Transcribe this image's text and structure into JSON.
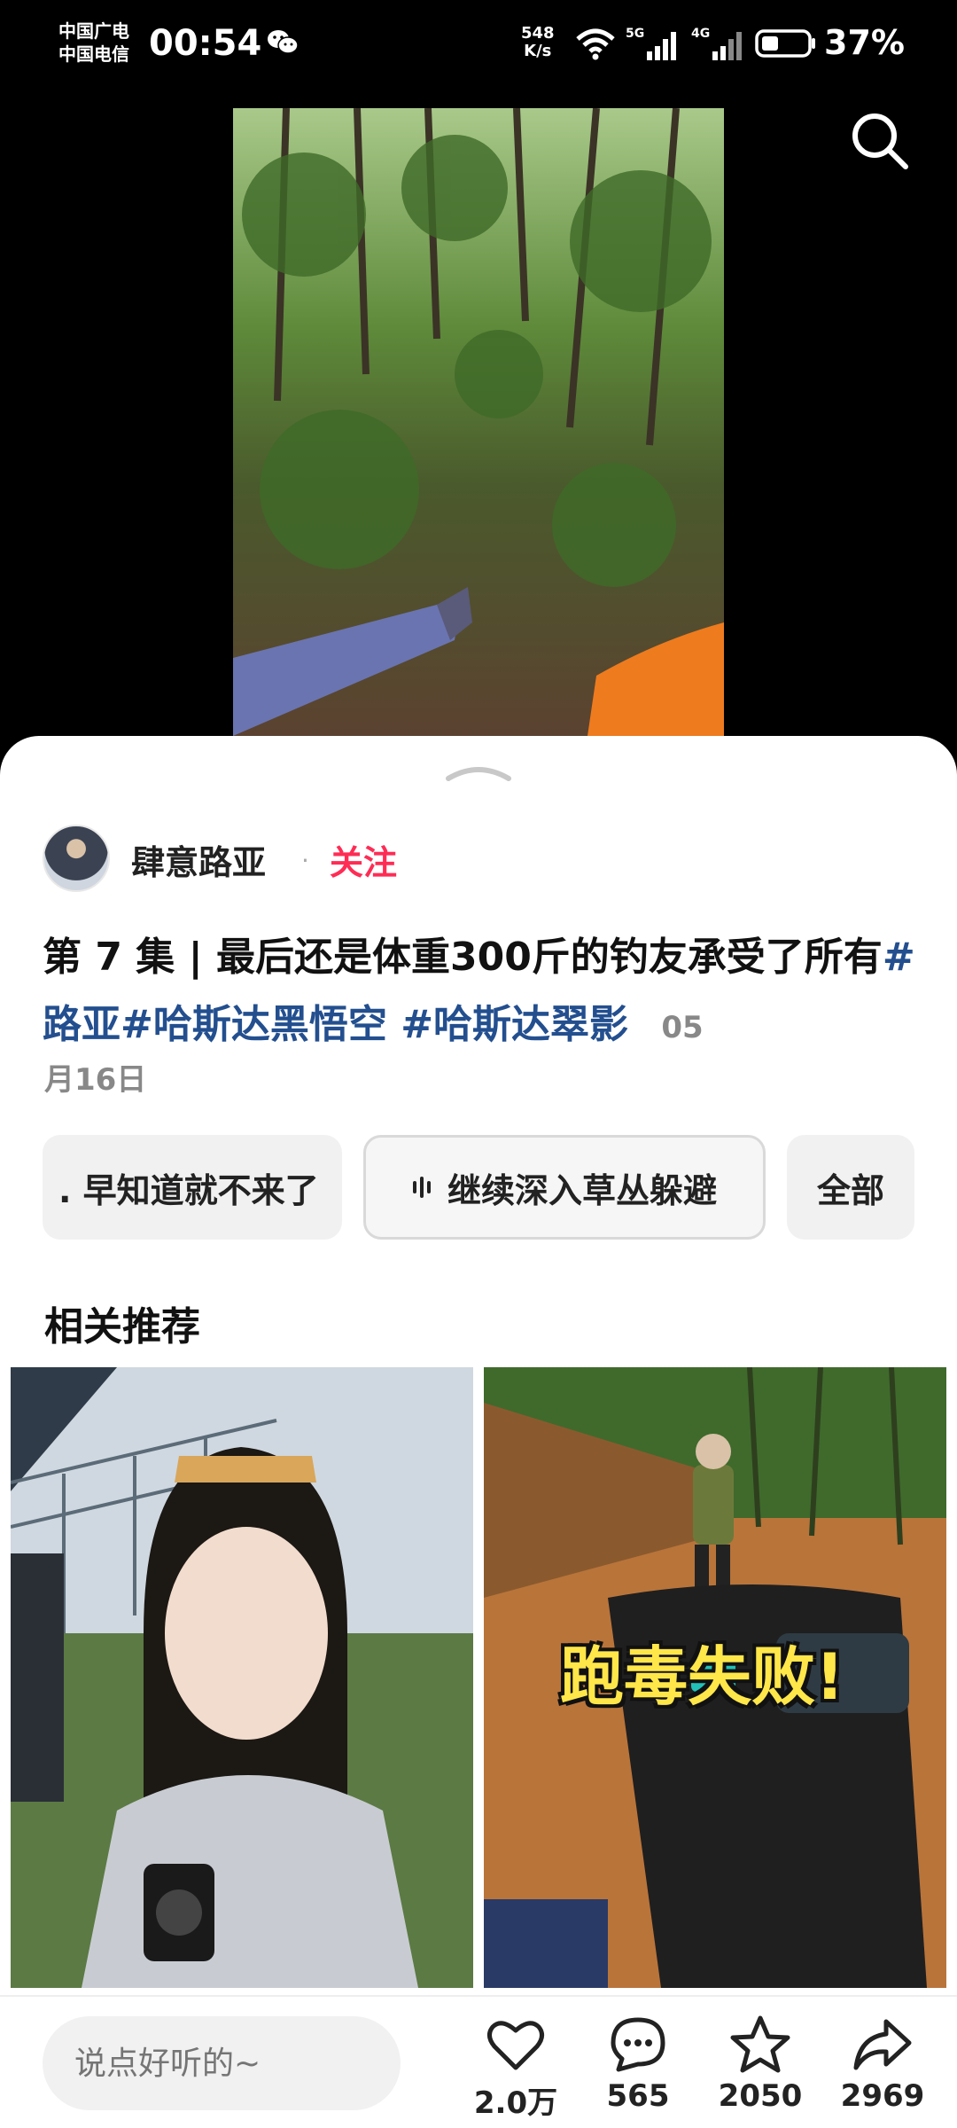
{
  "status_bar": {
    "carrier_1": "中国广电",
    "carrier_2": "中国电信",
    "time": "00:54",
    "net_speed_value": "548",
    "net_speed_unit": "K/s",
    "sig1_label": "5G",
    "sig2_label": "4G",
    "battery_pct": "37%"
  },
  "post": {
    "author": "肆意路亚",
    "separator": "·",
    "follow_label": "关注",
    "title_text": "第 7 集 | 最后还是体重300斤的钓友承受了所有",
    "tags": [
      "#路亚",
      "#哈斯达黑悟空",
      " #哈斯达翠影"
    ],
    "date_part1": "05",
    "date_part2": "月16日"
  },
  "chips": {
    "items": [
      ". 早知道就不来了",
      "继续深入草丛躲避",
      "全部"
    ]
  },
  "recommend": {
    "title": "相关推荐",
    "card2_overlay": "跑毒失败!"
  },
  "bottom_bar": {
    "comment_placeholder": "说点好听的~",
    "like_count": "2.0万",
    "comment_count": "565",
    "favorite_count": "2050",
    "share_count": "2969"
  },
  "colors": {
    "follow": "#fe2c55",
    "hashtag": "#234f8f",
    "overlay_text": "#ffe74a"
  }
}
